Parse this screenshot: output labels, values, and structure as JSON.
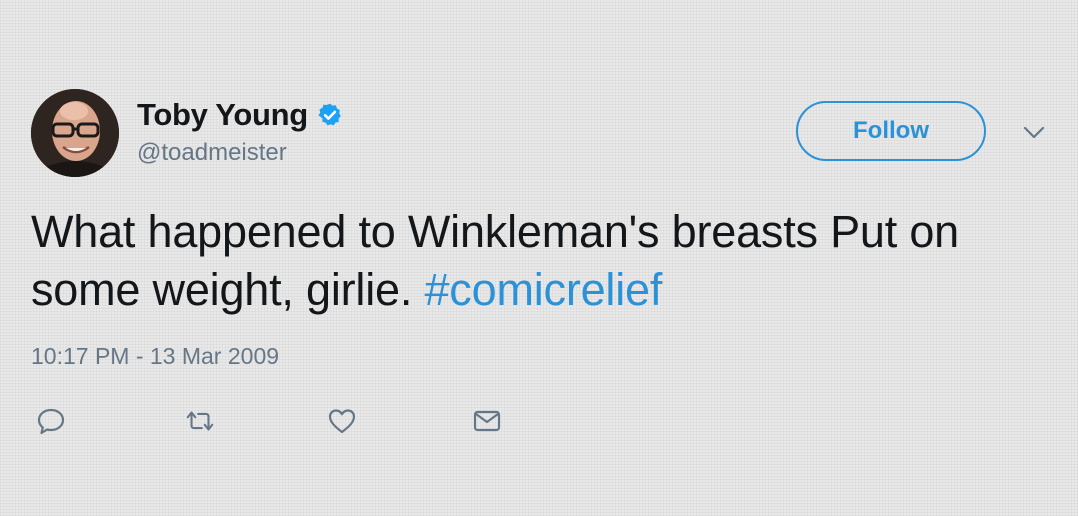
{
  "user": {
    "display_name": "Toby Young",
    "handle": "@toadmeister",
    "verified": true,
    "avatar_icon": "profile-photo"
  },
  "follow_button": {
    "label": "Follow"
  },
  "menu": {
    "icon": "chevron-down-icon"
  },
  "tweet": {
    "text": "What happened to Winkleman's breasts Put on some weight, girlie.",
    "hashtag": "#comicrelief",
    "timestamp": "10:17 PM - 13 Mar 2009"
  },
  "actions": [
    {
      "name": "reply",
      "icon": "speech-bubble-icon"
    },
    {
      "name": "retweet",
      "icon": "retweet-arrows-icon"
    },
    {
      "name": "like",
      "icon": "heart-icon"
    },
    {
      "name": "direct-message",
      "icon": "envelope-icon"
    }
  ],
  "colors": {
    "background": "#e9e9e9",
    "text": "#14171a",
    "secondary_text": "#657786",
    "accent": "#2b92d8",
    "verified": "#1da1f2"
  }
}
